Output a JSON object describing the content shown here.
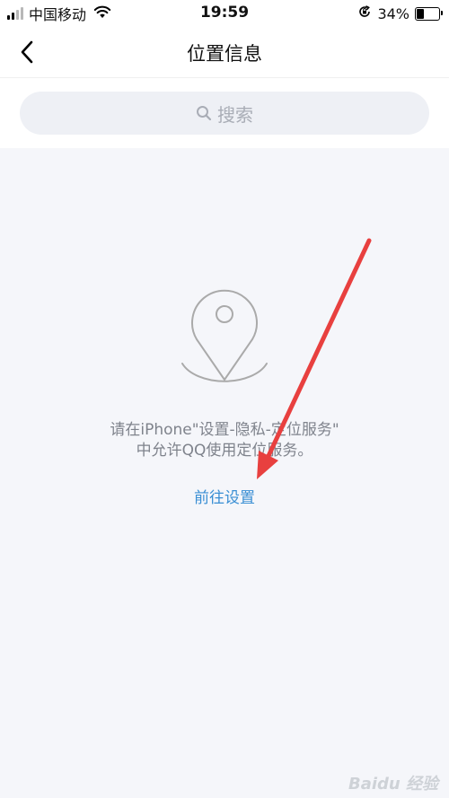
{
  "status_bar": {
    "carrier": "中国移动",
    "time": "19:59",
    "battery_percent": "34%",
    "battery_level": 0.34,
    "icons": [
      "signal-icon",
      "wifi-icon",
      "orientation-lock-icon",
      "battery-icon"
    ]
  },
  "nav": {
    "title": "位置信息",
    "back_icon": "chevron-left-icon"
  },
  "search": {
    "placeholder": "搜索",
    "icon": "search-icon"
  },
  "main": {
    "icon": "location-pin-icon",
    "message_line1": "请在iPhone\"设置-隐私-定位服务\"",
    "message_line2": "中允许QQ使用定位服务。",
    "settings_link": "前往设置"
  },
  "annotation": {
    "arrow_color": "#e8403f"
  },
  "watermark": {
    "text": "Baidu 经验"
  },
  "colors": {
    "link": "#3a8fd4",
    "background": "#f5f6fa",
    "message_text": "#7f838c"
  }
}
